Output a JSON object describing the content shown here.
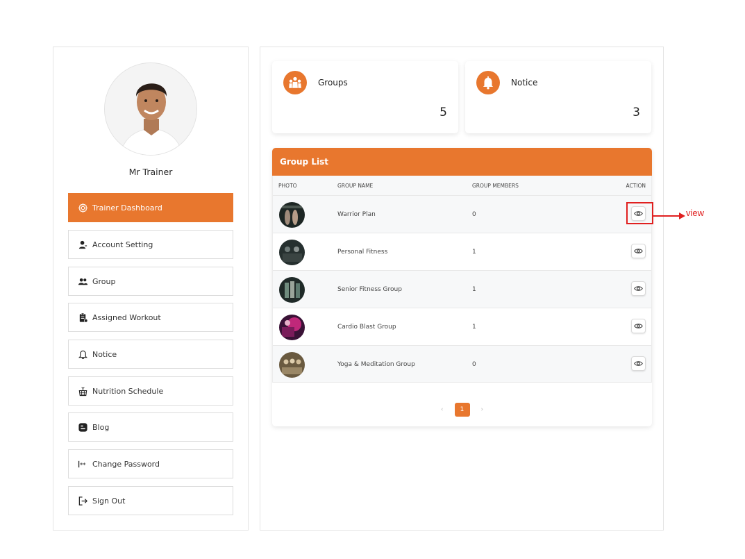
{
  "profile": {
    "name": "Mr Trainer"
  },
  "menu": [
    {
      "label": "Trainer Dashboard",
      "icon": "gear-icon",
      "active": true
    },
    {
      "label": "Account Setting",
      "icon": "user-edit-icon",
      "active": false
    },
    {
      "label": "Group",
      "icon": "users-icon",
      "active": false
    },
    {
      "label": "Assigned Workout",
      "icon": "clipboard-icon",
      "active": false
    },
    {
      "label": "Notice",
      "icon": "bell-icon",
      "active": false
    },
    {
      "label": "Nutrition Schedule",
      "icon": "food-basket-icon",
      "active": false
    },
    {
      "label": "Blog",
      "icon": "blogger-icon",
      "active": false
    },
    {
      "label": "Change Password",
      "icon": "password-icon",
      "active": false
    },
    {
      "label": "Sign Out",
      "icon": "sign-out-icon",
      "active": false
    }
  ],
  "stats": [
    {
      "label": "Groups",
      "value": "5",
      "icon": "group-people-icon"
    },
    {
      "label": "Notice",
      "value": "3",
      "icon": "bell-icon"
    }
  ],
  "group_list": {
    "title": "Group List",
    "columns": [
      "PHOTO",
      "GROUP NAME",
      "GROUP MEMBERS",
      "ACTION"
    ],
    "rows": [
      {
        "name": "Warrior Plan",
        "members": "0"
      },
      {
        "name": "Personal Fitness",
        "members": "1"
      },
      {
        "name": "Senior Fitness Group",
        "members": "1"
      },
      {
        "name": "Cardio Blast Group",
        "members": "1"
      },
      {
        "name": "Yoga & Meditation Group",
        "members": "0"
      }
    ],
    "pagination": {
      "prev": "‹",
      "current": "1",
      "next": "›"
    }
  },
  "annotation": {
    "text": "view"
  },
  "colors": {
    "accent": "#e8772e",
    "annotation": "#e02020"
  }
}
